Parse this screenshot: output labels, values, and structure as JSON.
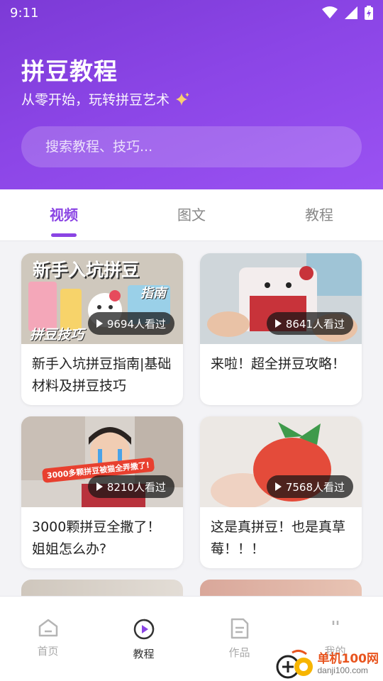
{
  "status_bar": {
    "time": "9:11"
  },
  "header": {
    "title": "拼豆教程",
    "subtitle": "从零开始，玩转拼豆艺术",
    "search_placeholder": "搜索教程、技巧..."
  },
  "tabs": [
    {
      "label": "视频",
      "active": true
    },
    {
      "label": "图文",
      "active": false
    },
    {
      "label": "教程",
      "active": false
    }
  ],
  "cards": [
    {
      "title": "新手入坑拼豆指南|基础材料及拼豆技巧",
      "views": "9694人看过",
      "thumb_text_1": "新手入坑拼豆",
      "thumb_text_2": "指南",
      "thumb_text_3": "拼豆技巧"
    },
    {
      "title": "来啦！超全拼豆攻略！",
      "views": "8641人看过"
    },
    {
      "title": "3000颗拼豆全撒了！姐姐怎么办?",
      "views": "8210人看过",
      "thumb_text_1": "3000多颗拼豆被猫全弄撒了!"
    },
    {
      "title": "这是真拼豆！也是真草莓！！！",
      "views": "7568人看过"
    }
  ],
  "bottom_nav": [
    {
      "label": "首页",
      "icon": "home-icon",
      "active": false
    },
    {
      "label": "教程",
      "icon": "play-circle-icon",
      "active": true
    },
    {
      "label": "作品",
      "icon": "document-icon",
      "active": false
    },
    {
      "label": "我的",
      "icon": "user-icon",
      "active": false
    }
  ],
  "watermark": {
    "name": "单机100网",
    "url": "danji100.com"
  },
  "colors": {
    "accent": "#8a44e4",
    "header_start": "#7c3ad6",
    "header_end": "#9a52f2"
  }
}
